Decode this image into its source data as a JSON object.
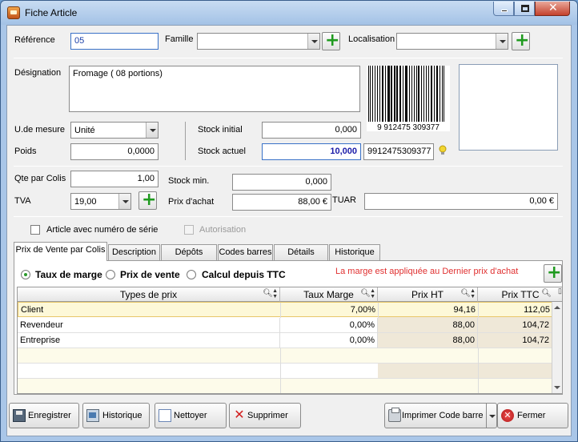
{
  "window": {
    "title": "Fiche Article",
    "min_glyph": "",
    "close_glyph": "✕"
  },
  "header": {
    "reference_label": "Référence",
    "reference_value": "05",
    "famille_label": "Famille",
    "famille_value": "",
    "localisation_label": "Localisation",
    "localisation_value": ""
  },
  "designation": {
    "label": "Désignation",
    "value": "Fromage ( 08 portions)"
  },
  "barcode": {
    "digits": "9 912475 309377",
    "code_value": "9912475309377"
  },
  "fields": {
    "udemesure_label": "U.de mesure",
    "udemesure_value": "Unité",
    "poids_label": "Poids",
    "poids_value": "0,0000",
    "stock_initial_label": "Stock initial",
    "stock_initial_value": "0,000",
    "stock_actuel_label": "Stock actuel",
    "stock_actuel_value": "10,000",
    "qte_colis_label": "Qte par Colis",
    "qte_colis_value": "1,00",
    "tva_label": "TVA",
    "tva_value": "19,00",
    "stock_min_label": "Stock min.",
    "stock_min_value": "0,000",
    "prix_achat_label": "Prix d'achat",
    "prix_achat_value": "88,00 €",
    "tuar_label": "TUAR",
    "tuar_value": "0,00 €"
  },
  "checks": {
    "serie_label": "Article avec numéro de série",
    "autorisation_label": "Autorisation"
  },
  "tabs": [
    {
      "label": "Prix de Vente par Colis"
    },
    {
      "label": "Description"
    },
    {
      "label": "Dépôts"
    },
    {
      "label": "Codes barres"
    },
    {
      "label": "Détails"
    },
    {
      "label": "Historique"
    }
  ],
  "pricing": {
    "radio_taux": "Taux de marge",
    "radio_prix": "Prix de vente",
    "radio_calcul": "Calcul depuis TTC",
    "note": "La marge est appliquée au Dernier prix d'achat",
    "note_color": "#e03030",
    "columns": [
      "Types de prix",
      "Taux Marge",
      "Prix HT",
      "Prix TTC"
    ],
    "rows": [
      {
        "type": "Client",
        "taux": "7,00%",
        "ht": "94,16",
        "ttc": "112,05"
      },
      {
        "type": "Revendeur",
        "taux": "0,00%",
        "ht": "88,00",
        "ttc": "104,72"
      },
      {
        "type": "Entreprise",
        "taux": "0,00%",
        "ht": "88,00",
        "ttc": "104,72"
      }
    ]
  },
  "buttons": {
    "enregistrer": "Enregistrer",
    "historique": "Historique",
    "nettoyer": "Nettoyer",
    "supprimer": "Supprimer",
    "imprimer": "Imprimer Code barre",
    "fermer": "Fermer",
    "close_glyph": "✕",
    "del_glyph": "✕"
  },
  "colors": {
    "accent_green": "#1f9a1f",
    "stock_actuel_text": "#1a1aa8",
    "row_highlight": "#fdf8d8",
    "price_col_bg": "#efe8d8"
  }
}
